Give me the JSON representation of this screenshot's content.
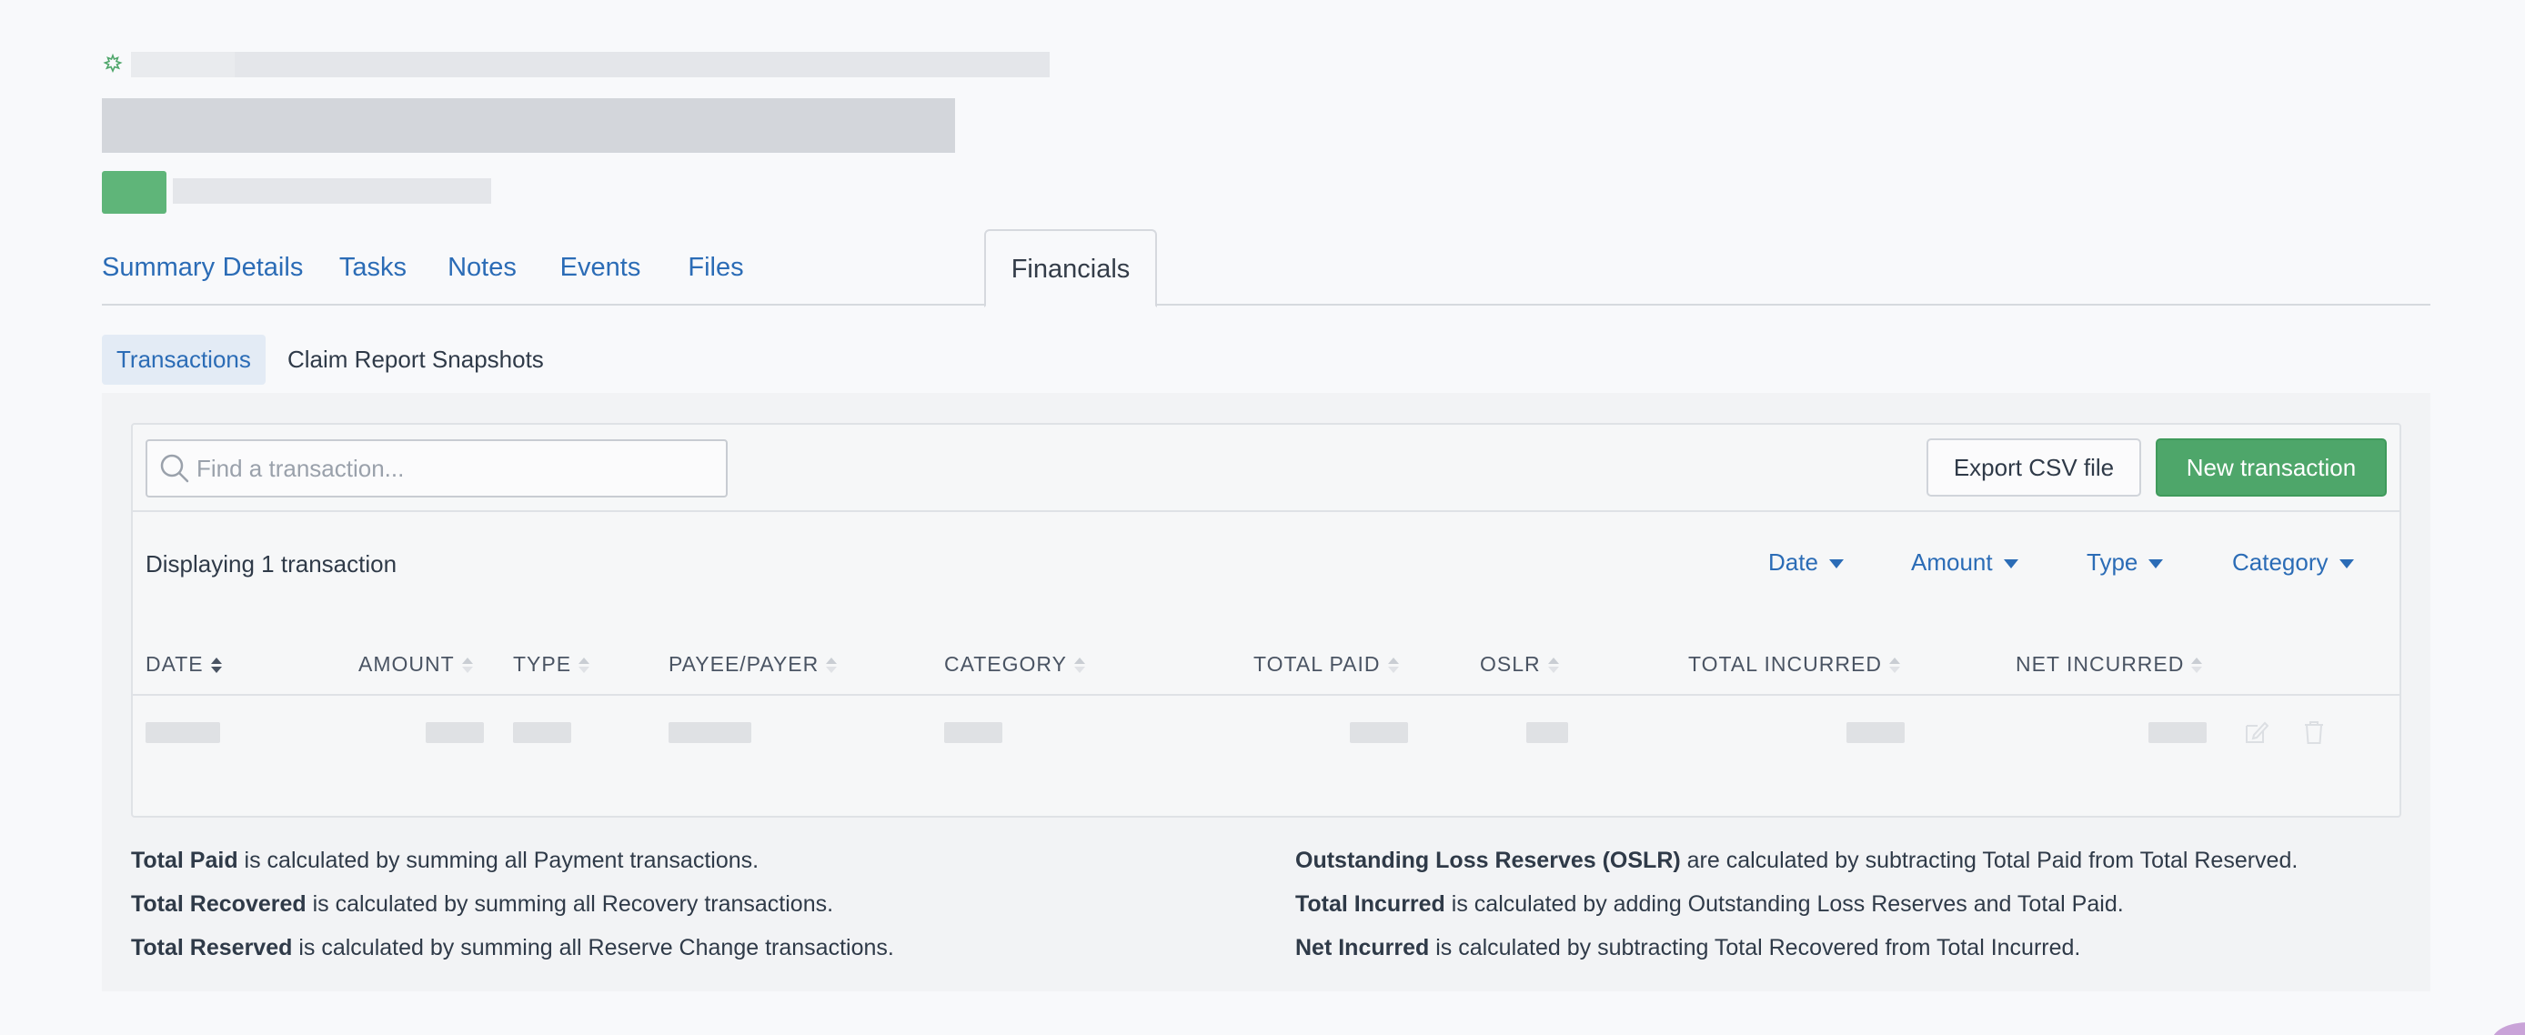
{
  "tabs": [
    {
      "label": "Summary"
    },
    {
      "label": "Details"
    },
    {
      "label": "Tasks"
    },
    {
      "label": "Notes"
    },
    {
      "label": "Events"
    },
    {
      "label": "Files"
    },
    {
      "label": "Financials",
      "active": true
    }
  ],
  "subtabs": [
    {
      "label": "Transactions",
      "active": true
    },
    {
      "label": "Claim Report Snapshots"
    }
  ],
  "search": {
    "placeholder": "Find a transaction..."
  },
  "buttons": {
    "export": "Export CSV file",
    "new": "New transaction"
  },
  "display_count": "Displaying 1 transaction",
  "filters": [
    "Date",
    "Amount",
    "Type",
    "Category"
  ],
  "columns": [
    "DATE",
    "AMOUNT",
    "TYPE",
    "PAYEE/PAYER",
    "CATEGORY",
    "TOTAL PAID",
    "OSLR",
    "TOTAL INCURRED",
    "NET INCURRED"
  ],
  "notes": {
    "left": [
      {
        "term": "Total Paid",
        "text": " is calculated by summing all Payment transactions."
      },
      {
        "term": "Total Recovered",
        "text": " is calculated by summing all Recovery transactions."
      },
      {
        "term": "Total Reserved",
        "text": " is calculated by summing all Reserve Change transactions."
      }
    ],
    "right": [
      {
        "term": "Outstanding Loss Reserves (OSLR)",
        "text": " are calculated by subtracting Total Paid from Total Reserved."
      },
      {
        "term": "Total Incurred",
        "text": " is calculated by adding Outstanding Loss Reserves and Total Paid."
      },
      {
        "term": "Net Incurred",
        "text": " is calculated by subtracting Total Recovered from Total Incurred."
      }
    ]
  },
  "colors": {
    "accent": "#2b6cb6",
    "primary_button": "#4ea66a",
    "loading_badge": "#5fb579"
  },
  "icons": {
    "spinner": "loading-spinner-icon",
    "search": "search-icon",
    "edit": "edit-icon",
    "delete": "trash-icon"
  }
}
